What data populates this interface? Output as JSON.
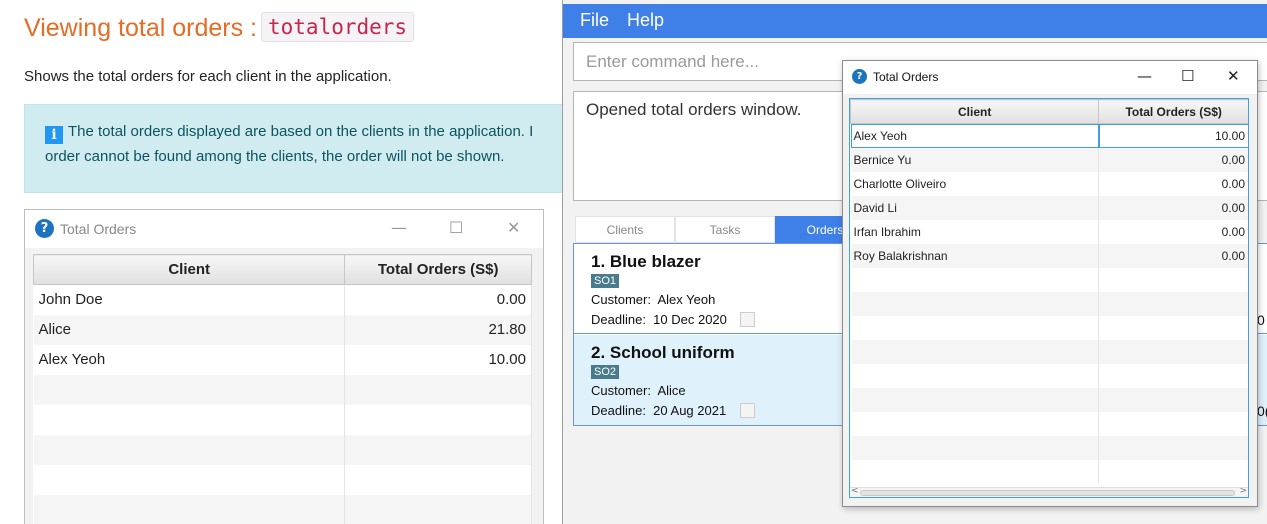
{
  "doc": {
    "title_prefix": "Viewing total orders :",
    "title_command": "totalorders",
    "description": "Shows the total orders for each client in the application.",
    "info_line1": "The total orders displayed are based on the clients in the application. I",
    "info_line2": "order cannot be found among the clients, the order will not be shown.",
    "info_icon": "i"
  },
  "left_window": {
    "title": "Total Orders",
    "icon": "question-icon",
    "columns": [
      "Client",
      "Total Orders (S$)"
    ],
    "rows": [
      [
        "John Doe",
        "0.00"
      ],
      [
        "Alice",
        "21.80"
      ],
      [
        "Alex Yeoh",
        "10.00"
      ]
    ]
  },
  "app": {
    "menu": {
      "file": "File",
      "help": "Help"
    },
    "command_placeholder": "Enter command here...",
    "result_text": "Opened total orders window.",
    "tabs": [
      "Clients",
      "Tasks",
      "Orders"
    ],
    "active_tab": "Orders",
    "orders": [
      {
        "name": "1. Blue blazer",
        "tag": "SO1",
        "customer_label": "Customer:",
        "customer": "Alex Yeoh",
        "deadline_label": "Deadline:",
        "deadline": "10 Dec 2020",
        "right_text": "0"
      },
      {
        "name": "2. School uniform",
        "tag": "SO2",
        "customer_label": "Customer:",
        "customer": "Alice",
        "deadline_label": "Deadline:",
        "deadline": "20 Aug 2021",
        "right_text": "0("
      }
    ],
    "colors": {
      "menu_bar": "#3f7fe8",
      "selected_card": "#dff1fb",
      "tag": "#4a7b8c"
    }
  },
  "popup": {
    "title": "Total Orders",
    "icon": "question-icon",
    "controls": {
      "minimize": "—",
      "maximize": "☐",
      "close": "✕"
    },
    "columns": [
      "Client",
      "Total Orders (S$)"
    ],
    "rows": [
      [
        "Alex Yeoh",
        "10.00"
      ],
      [
        "Bernice Yu",
        "0.00"
      ],
      [
        "Charlotte Oliveiro",
        "0.00"
      ],
      [
        "David Li",
        "0.00"
      ],
      [
        "Irfan Ibrahim",
        "0.00"
      ],
      [
        "Roy Balakrishnan",
        "0.00"
      ]
    ]
  }
}
